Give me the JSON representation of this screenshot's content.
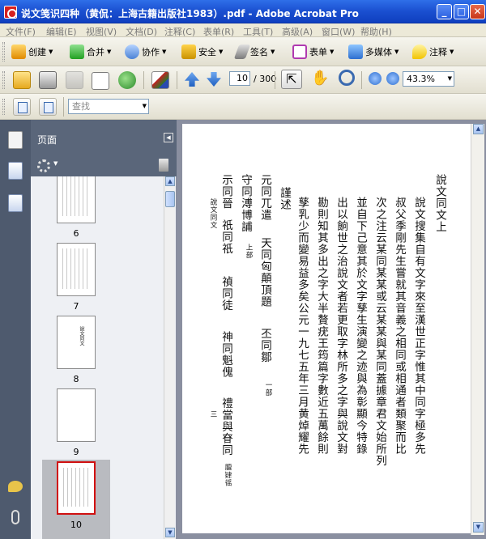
{
  "window": {
    "title": "说文笺识四种（黄侃：上海古籍出版社1983）.pdf - Adobe Acrobat Pro"
  },
  "menu": {
    "items": [
      "文件(F)",
      "编辑(E)",
      "视图(V)",
      "文档(D)",
      "注释(C)",
      "表单(R)",
      "工具(T)",
      "高级(A)",
      "窗口(W)",
      "帮助(H)"
    ]
  },
  "toolbar1": {
    "create": "创建",
    "combine": "合并",
    "collaborate": "协作",
    "secure": "安全",
    "sign": "签名",
    "forms": "表单",
    "multimedia": "多媒体",
    "comment": "注释"
  },
  "toolbar2": {
    "page_current": "10",
    "page_total": "/ 300",
    "zoom": "43.3%"
  },
  "toolbar3": {
    "find_placeholder": "查找"
  },
  "panel": {
    "title": "页面",
    "thumbnails": [
      {
        "label": "6"
      },
      {
        "label": "7"
      },
      {
        "label": "8",
        "text": "說文同文"
      },
      {
        "label": "9"
      },
      {
        "label": "10"
      }
    ]
  },
  "document": {
    "columns": [
      "說文同文上",
      "說文搜集自有文字來至漢世正字惟其中同字極多先",
      "叔父季剛先生嘗就其音義之相同或相通者類聚而比",
      "次之注云某同某某或云某某與某同蓋據章君文始所列",
      "並自下己意其於文字孳生演變之迹與為彰顯今特錄",
      "出以餉世之治說文者若更取字林所多之字與說文對",
      "勘則知其多出之字大半贅疣王筠篇字數近五萬餘則",
      "孳乳少而變易益多矣公元一九七五年三月黄焯耀先",
      "謹述",
      "元同兀遣",
      "天同匈顛頂題",
      "丕同鄒",
      "守同溥博誧",
      "上部",
      "一部",
      "示同晉",
      "祇同祇",
      "禎同徒",
      "神同魁傀",
      "禮當與眘同",
      "說文同文",
      "三"
    ],
    "small": {
      "yiyi": "膻肄徭"
    }
  }
}
